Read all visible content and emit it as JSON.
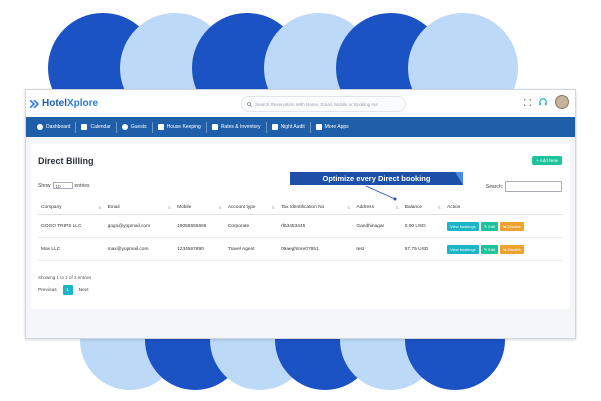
{
  "colors": {
    "brand": "#1f5fa9",
    "accent": "#1ab5c7",
    "success": "#1fc39b",
    "warning": "#f0a22e",
    "callout": "#1d4fa8"
  },
  "app": {
    "logo_text_1": "Hotel",
    "logo_text_2": "Xplore"
  },
  "search": {
    "placeholder": "Search Reservation With Name, Email, Mobile or Booking nur"
  },
  "nav": {
    "items": [
      {
        "label": "Dashboard",
        "icon": "dashboard-icon"
      },
      {
        "label": "Calendar",
        "icon": "calendar-icon"
      },
      {
        "label": "Guests",
        "icon": "guests-icon"
      },
      {
        "label": "House Keeping",
        "icon": "housekeeping-icon"
      },
      {
        "label": "Rates & Inventory",
        "icon": "rates-icon"
      },
      {
        "label": "Night Audit",
        "icon": "night-audit-icon"
      },
      {
        "label": "More Apps",
        "icon": "apps-icon"
      }
    ]
  },
  "page": {
    "title": "Direct Billing",
    "add_button": "+ Add New",
    "show_label": "Show",
    "entries_value": "10",
    "entries_label": "entries",
    "search_label": "Search:"
  },
  "callout": {
    "text": "Optimize every Direct booking"
  },
  "table": {
    "headers": [
      "Company",
      "Email",
      "Mobile",
      "Account type",
      "Tax Identification No",
      "Address",
      "Balance",
      "Action"
    ],
    "rows": [
      {
        "company": "GOGO TRIPS LLC",
        "email": "gogo@yopmail.com",
        "mobile": "19055555666",
        "account_type": "Corporate",
        "tax_id": "rf63453445",
        "address": "Gandhinagar",
        "balance": "0.00 USD"
      },
      {
        "company": "Max LLC",
        "email": "max@yopmail.com",
        "mobile": "1234567890",
        "account_type": "Travel Agent",
        "tax_id": "09aeghtnre07651",
        "address": "test",
        "balance": "57.75 USD"
      }
    ],
    "view_label": "View bookings",
    "edit_label": "✎ Edit",
    "disable_label": "⇆ Disable"
  },
  "footer": {
    "showing": "Showing 1 to 2 of 2 entries",
    "previous": "Previous",
    "current_page": "1",
    "next": "Next"
  }
}
